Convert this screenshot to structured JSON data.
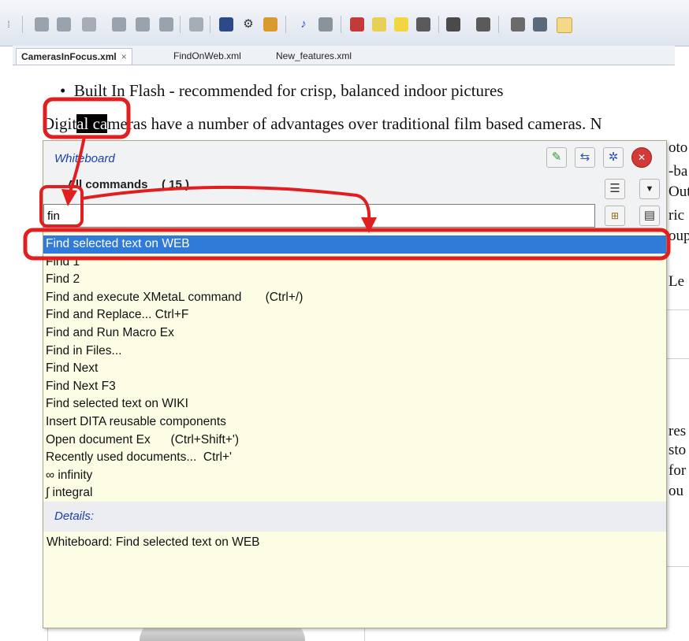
{
  "toolbar": {
    "icons": [
      "grip-icon",
      "doc-1-icon",
      "doc-2-icon",
      "arrow-icon",
      "doc-3-icon",
      "doc-4-icon",
      "doc-5-icon",
      "paint-icon",
      "books-icon",
      "gear-icon",
      "user-icon",
      "note-icon",
      "stop-icon",
      "book-icon",
      "clip-icon",
      "tag-icon",
      "puzzle-icon",
      "puzzle-2-icon",
      "window-icon",
      "code-icon",
      "image-icon",
      "edit-icon"
    ]
  },
  "tabs": [
    {
      "label": "CamerasInFocus.xml",
      "active": true,
      "close": "×"
    },
    {
      "label": "FindOnWeb.xml",
      "active": false
    },
    {
      "label": "New_features.xml",
      "active": false
    }
  ],
  "document": {
    "bullet": "•",
    "bullet_text": "Built In Flash - recommended for crisp, balanced indoor pictures",
    "para_before": "Digit",
    "para_highlight": "al ca",
    "para_after": "meras have a number of advantages over traditional film based cameras. N",
    "peek_lines": [
      "oto",
      "-ba",
      "Out",
      "ric",
      "oup",
      "Le",
      "res",
      "sto",
      "for",
      "ou"
    ]
  },
  "whiteboard": {
    "title": "Whiteboard",
    "count_label": "All commands",
    "count": "( 15 )",
    "search_value": "fin",
    "header_icons": [
      "pin-icon",
      "layout-icon",
      "settings-icon",
      "close-icon"
    ],
    "side_icons": [
      "list-view-icon",
      "dropdown-icon",
      "command-icon",
      "document-icon"
    ],
    "commands": [
      "Find selected text on WEB",
      "Find 1",
      "Find 2",
      "Find and execute XMetaL command       (Ctrl+/)",
      "Find and Replace... Ctrl+F",
      "Find and Run Macro Ex",
      "Find in Files...",
      "Find Next",
      "Find Next F3",
      "Find selected text on WIKI",
      "Insert DITA reusable components",
      "Open document Ex      (Ctrl+Shift+')",
      "Recently used documents...  Ctrl+'",
      "∞ infinity",
      "∫ integral"
    ],
    "selected_index": 0,
    "details_label": "Details:",
    "details_text": "Whiteboard: Find selected text on WEB"
  },
  "colors": {
    "selection": "#2f7bd7",
    "popup_bg": "#fdfde6",
    "annotation": "#e02020",
    "title_blue": "#1c3fa8"
  }
}
